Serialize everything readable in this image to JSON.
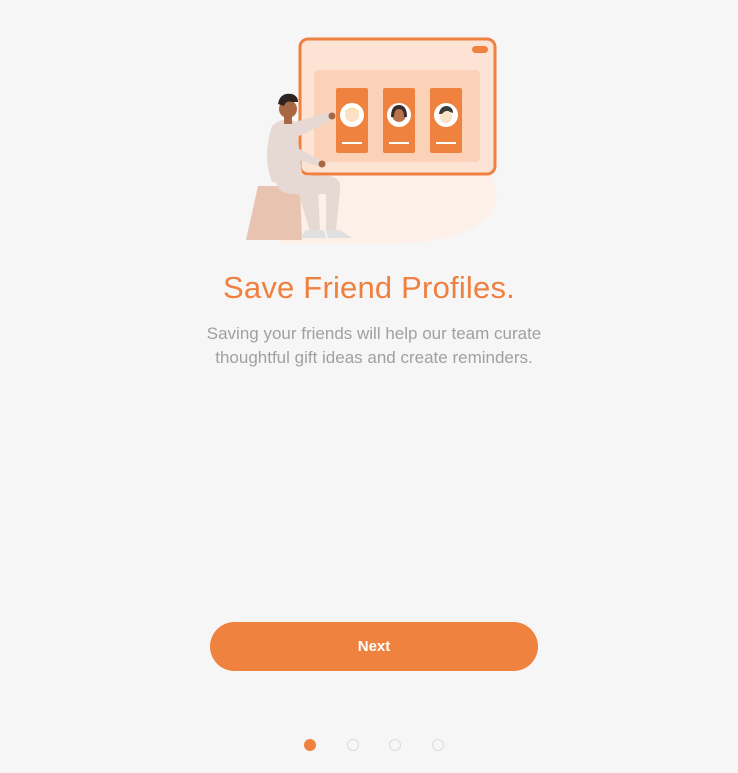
{
  "onboarding": {
    "title": "Save Friend Profiles.",
    "subtitle": "Saving your friends will help our team curate thoughtful gift ideas and create reminders.",
    "next_label": "Next",
    "current_step": 1,
    "total_steps": 4
  },
  "colors": {
    "accent": "#f0823f",
    "subtitle_text": "#a0a0a0",
    "background": "#f6f6f6"
  },
  "icons": {
    "illustration": "person-selecting-friend-profiles-illustration"
  }
}
